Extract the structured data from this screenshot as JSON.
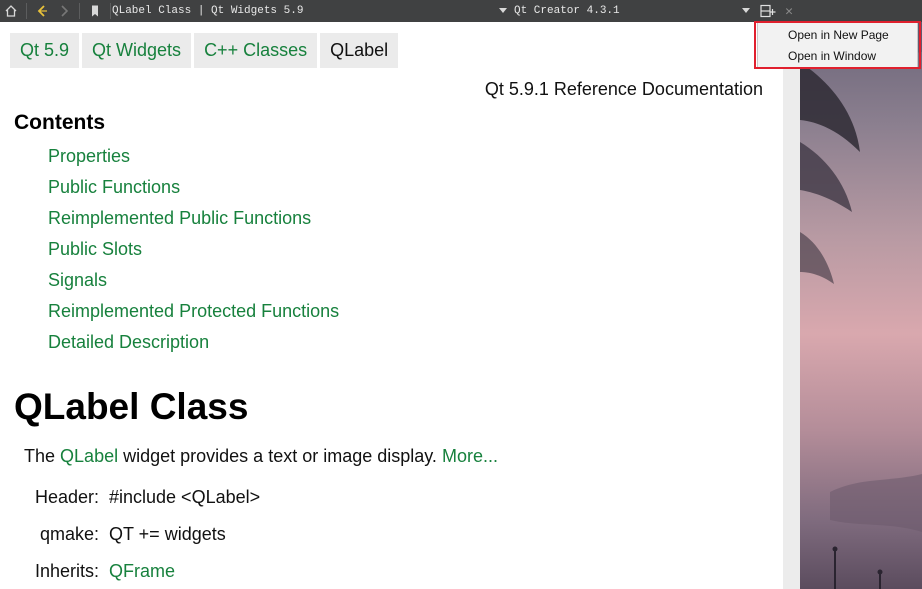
{
  "toolbar": {
    "breadcrumb": "QLabel Class | Qt Widgets 5.9",
    "creator_version": "Qt Creator 4.3.1",
    "icons": [
      "home-icon",
      "back-icon",
      "forward-icon",
      "bookmark-icon",
      "dropdown-icon",
      "split-icon",
      "close-icon"
    ],
    "close_glyph": "✕"
  },
  "nav": {
    "items": [
      {
        "label": "Qt 5.9"
      },
      {
        "label": "Qt Widgets"
      },
      {
        "label": "C++ Classes"
      },
      {
        "label": "QLabel"
      }
    ]
  },
  "doc": {
    "reference_title": "Qt 5.9.1 Reference Documentation",
    "contents_heading": "Contents",
    "toc": [
      "Properties",
      "Public Functions",
      "Reimplemented Public Functions",
      "Public Slots",
      "Signals",
      "Reimplemented Protected Functions",
      "Detailed Description"
    ],
    "class_title": "QLabel Class",
    "brief": {
      "prefix": "The",
      "class_link": "QLabel",
      "text": "widget provides a text or image display.",
      "more_link": "More..."
    },
    "info": {
      "header_key": "Header:",
      "header_value": "#include <QLabel>",
      "qmake_key": "qmake:",
      "qmake_value": "QT += widgets",
      "inherits_key": "Inherits:",
      "inherits_value": "QFrame"
    }
  },
  "context_menu": {
    "items": [
      "Open in New Page",
      "Open in Window"
    ]
  },
  "colors": {
    "link": "#17813d",
    "toolbar_bg": "#404142",
    "highlight": "#e0202e"
  }
}
